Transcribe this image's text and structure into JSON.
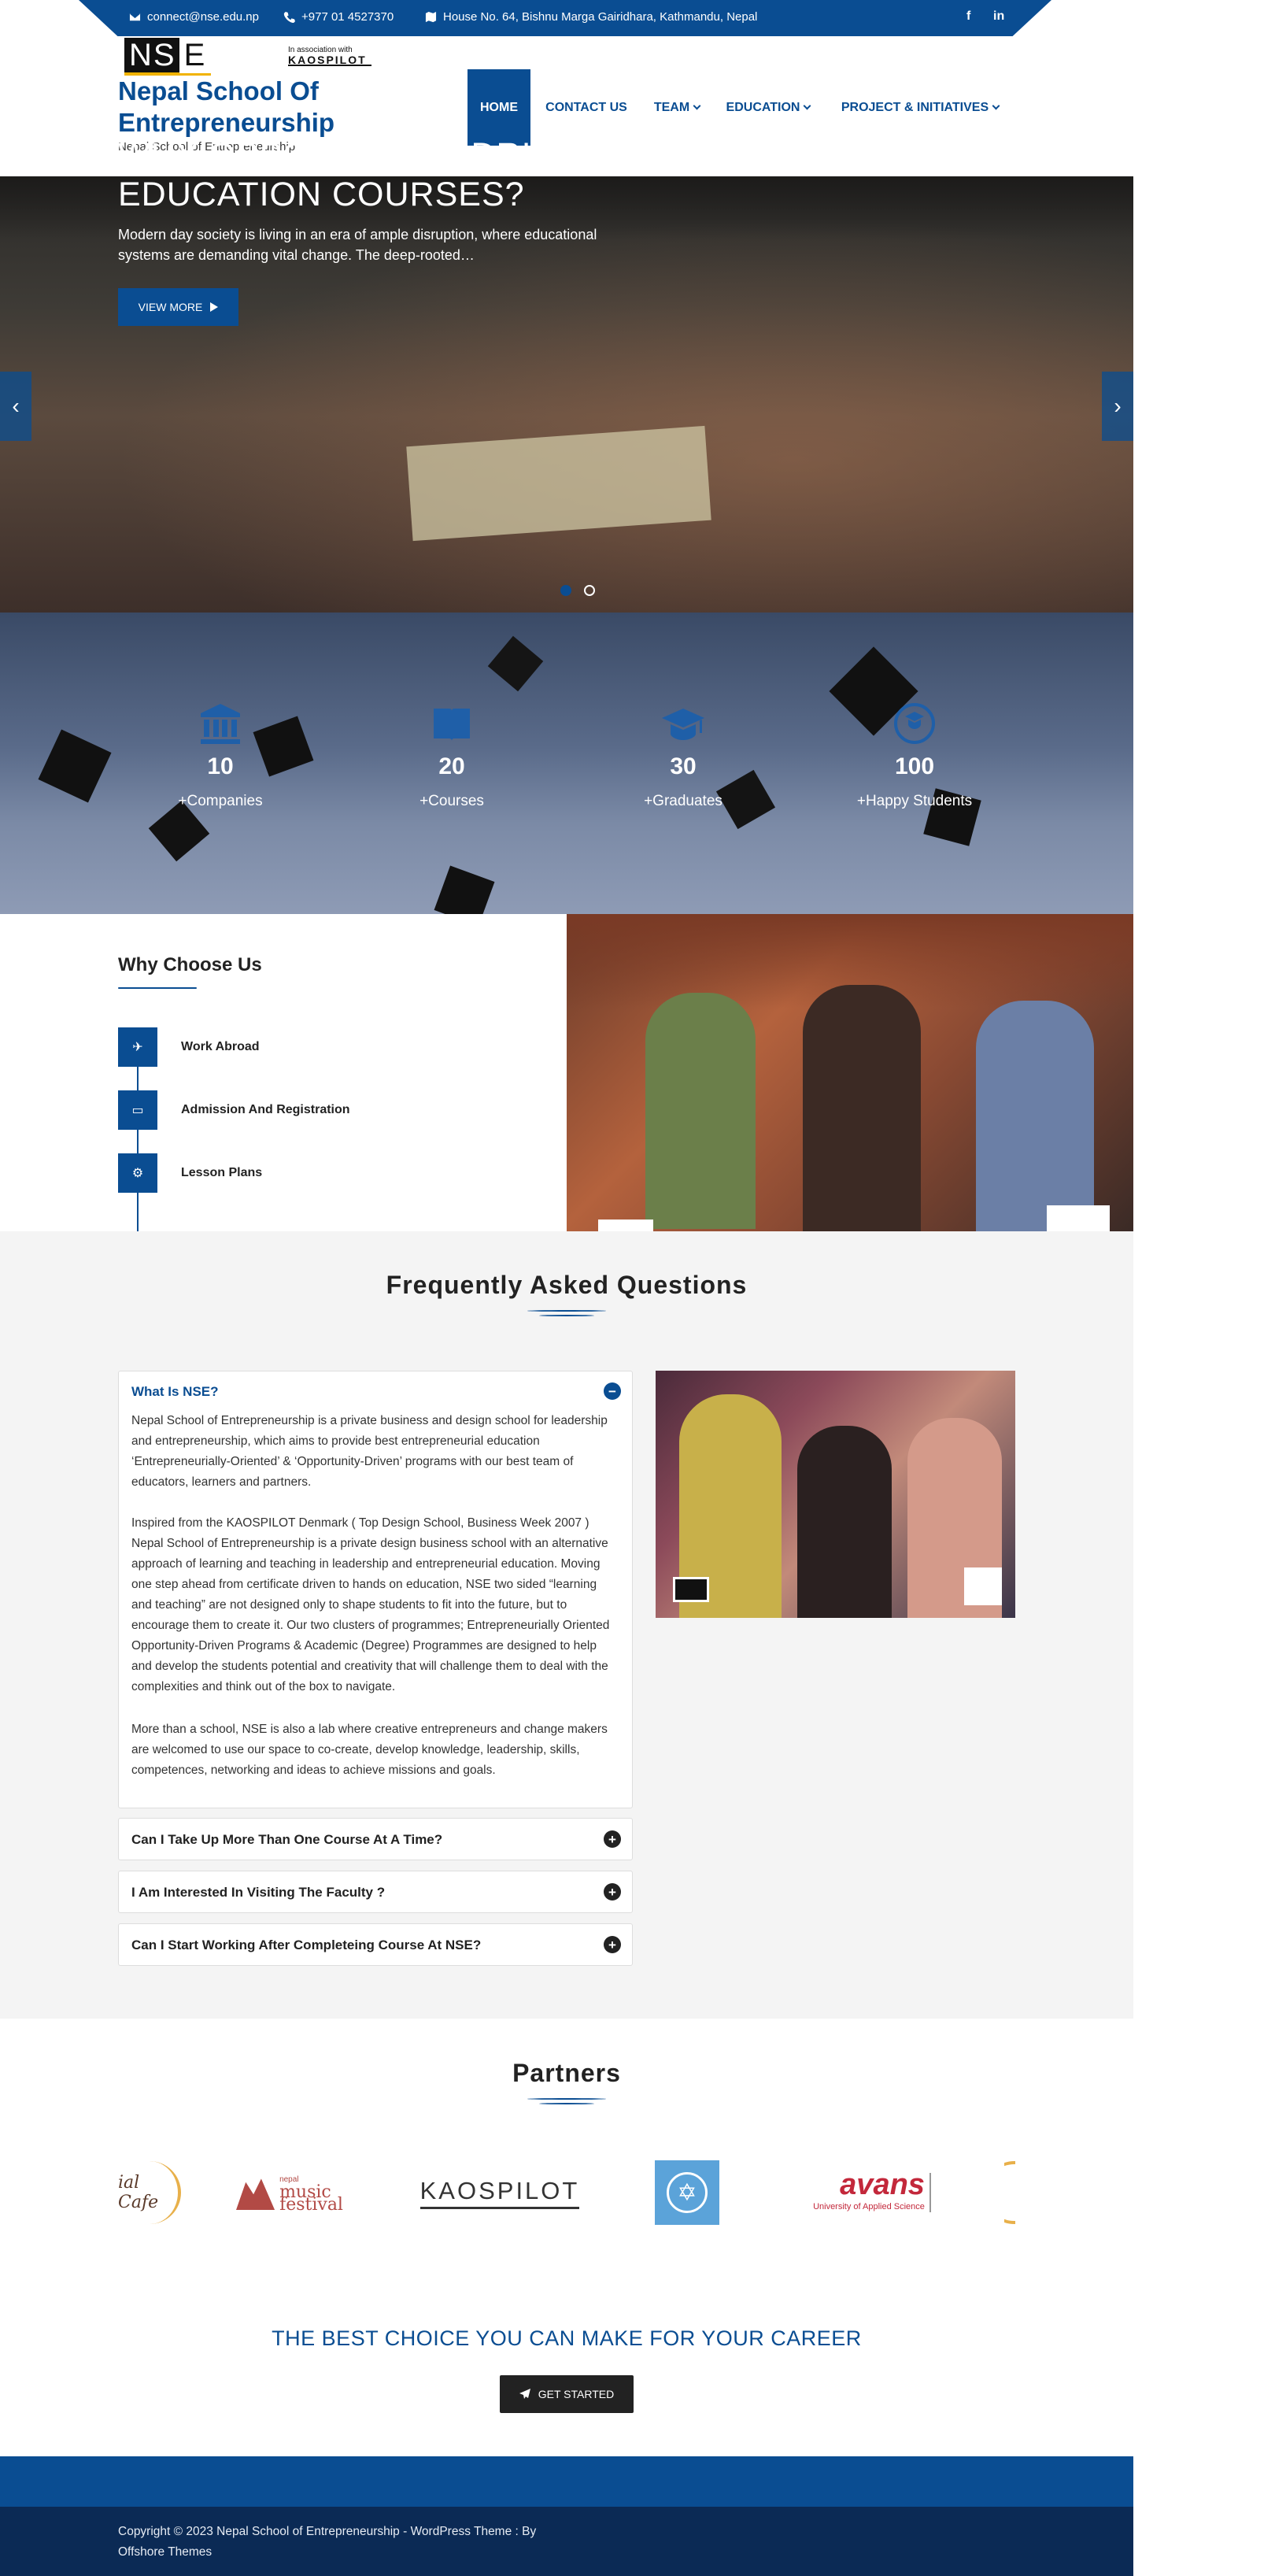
{
  "topbar": {
    "email": "connect@nse.edu.np",
    "phone": "+977 01 4527370",
    "address": "House No. 64, Bishnu Marga Gairidhara, Kathmandu, Nepal",
    "social": [
      "f",
      "in"
    ]
  },
  "header": {
    "logo_text": "NS",
    "logo_letter": "E",
    "assoc_line": "In association with",
    "assoc_brand": "KAOSPILOT",
    "site_title": "Nepal School Of Entrepreneurship",
    "tagline": "Nepal School of Entrepreneurship"
  },
  "nav": {
    "items": [
      {
        "label": "HOME",
        "active": true
      },
      {
        "label": "CONTACT US"
      },
      {
        "label": "TEAM"
      },
      {
        "label": "EDUCATION"
      },
      {
        "label": "PROJECT & INITIATIVES"
      }
    ]
  },
  "hero": {
    "title": "WHY OPPORTUNITY DRIVEN EDUCATION COURSES?",
    "text": "Modern day society is living in an era of ample disruption, where educational systems are demanding vital change. The deep-rooted…",
    "button": "VIEW MORE",
    "prev": "‹",
    "next": "›"
  },
  "counters": [
    {
      "icon": "bank-icon",
      "value": "10",
      "label": "+Companies"
    },
    {
      "icon": "book-icon",
      "value": "20",
      "label": "+Courses"
    },
    {
      "icon": "graduation-cap-icon",
      "value": "30",
      "label": "+Graduates"
    },
    {
      "icon": "happy-student-icon",
      "value": "100",
      "label": "+Happy Students"
    }
  ],
  "why": {
    "title": "Why Choose Us",
    "items": [
      {
        "icon": "plane-icon",
        "label": "Work Abroad"
      },
      {
        "icon": "inbox-icon",
        "label": "Admission And Registration"
      },
      {
        "icon": "cogs-icon",
        "label": "Lesson Plans"
      }
    ]
  },
  "faq": {
    "title": "Frequently Asked Questions",
    "open": {
      "question": "What Is NSE?",
      "toggle": "−",
      "answers": [
        "Nepal School of Entrepreneurship is a private business and design school for leadership and entrepreneurship, which aims to provide best entrepreneurial education ‘Entrepreneurially-Oriented’ & ‘Opportunity-Driven’ programs with our best team of educators, learners and partners.",
        "Inspired from the KAOSPILOT Denmark ( Top Design School, Business Week 2007 ) Nepal School of Entrepreneurship is a private design business school with an alternative approach of learning and teaching in leadership and entrepreneurial education. Moving one step ahead from certificate driven to hands on education, NSE two sided “learning and teaching” are not designed only to shape students to fit into the future, but to encourage them to create it. Our two clusters of programmes; Entrepreneurially Oriented Opportunity-Driven Programs & Academic (Degree) Programmes are designed to help and develop the students potential and creativity that will challenge them to deal with the complexities and think out of the box to navigate.",
        "More than a school, NSE is also a lab where creative entrepreneurs and change makers are welcomed to use our space to co-create, develop knowledge, leadership, skills, competences, networking and ideas to achieve missions and goals."
      ]
    },
    "closed": [
      {
        "question": "Can I Take Up More Than One Course At A Time?",
        "toggle": "+"
      },
      {
        "question": "I Am Interested In Visiting The Faculty ?",
        "toggle": "+"
      },
      {
        "question": "Can I Start Working After Completeing Course At NSE?",
        "toggle": "+"
      }
    ]
  },
  "partners": {
    "title": "Partners",
    "logos": [
      {
        "name": "social-cafe-logo",
        "text": "ial Cafe"
      },
      {
        "name": "nepal-music-festival-logo",
        "text": "music festival",
        "small": "nepal"
      },
      {
        "name": "kaospilot-logo",
        "text": "KAOSPILOT"
      },
      {
        "name": "university-seal-logo",
        "text": ""
      },
      {
        "name": "avans-logo",
        "text": "avans",
        "small": "University of Applied Science"
      }
    ]
  },
  "cta": {
    "text": "THE BEST CHOICE YOU CAN MAKE FOR YOUR CAREER",
    "button": "GET STARTED"
  },
  "footer": {
    "copyright": "Copyright © 2023 Nepal School of Entrepreneurship - WordPress Theme : By",
    "credit": "Offshore Themes"
  },
  "colors": {
    "primary": "#0a4d92",
    "footer_dark": "#0b2a55",
    "faq_bg": "#f4f4f4"
  }
}
